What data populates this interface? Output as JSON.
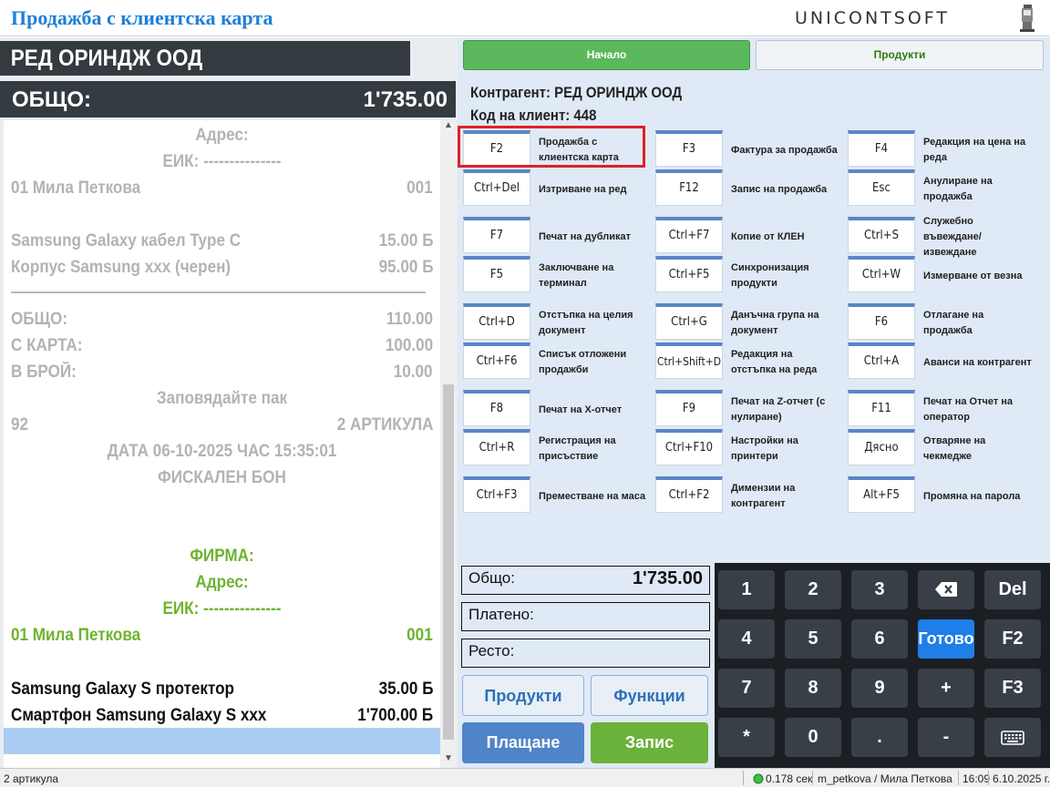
{
  "app": {
    "title": "Продажба с клиентска карта",
    "brand": "UNICONTSOFT"
  },
  "client": {
    "name": "РЕД ОРИНДЖ ООД"
  },
  "total": {
    "label": "ОБЩО:",
    "value": "1'735.00"
  },
  "receipt": {
    "address_label": "Адрес:",
    "eik": "ЕИК: ---------------",
    "operator": "01 Мила Петкова",
    "operator_code": "001",
    "items": [
      {
        "name": "Samsung Galaxy кабел Type C",
        "price": "15.00 Б"
      },
      {
        "name": "Корпус Samsung xxx (черен)",
        "price": "95.00 Б"
      }
    ],
    "totals": [
      {
        "label": "ОБЩО:",
        "value": "110.00"
      },
      {
        "label": "С КАРТА:",
        "value": "100.00"
      },
      {
        "label": "В БРОЙ:",
        "value": "10.00"
      }
    ],
    "thanks": "Заповядайте пак",
    "receipt_no": "92",
    "article_count": "2 АРТИКУЛА",
    "datetime": "ДАТА 06-10-2025  ЧАС 15:35:01",
    "fiscal": "ФИСКАЛЕН БОН",
    "firm_label": "ФИРМА:",
    "firm_address": "Адрес:",
    "firm_eik": "ЕИК: ---------------",
    "firm_operator": "01 Мила Петкова",
    "firm_operator_code": "001",
    "new_items": [
      {
        "name": "Samsung Galaxy S протектор",
        "price": "35.00 Б"
      },
      {
        "name": "Смартфон Samsung Galaxy S  xxx",
        "price": "1'700.00 Б"
      }
    ]
  },
  "tabs": {
    "home": "Начало",
    "products": "Продукти"
  },
  "contractor": {
    "label": "Контрагент: РЕД ОРИНДЖ ООД",
    "code": "Код на клиент: 448"
  },
  "hotkeys": [
    {
      "key": "F2",
      "label": "Продажба с клиентска карта"
    },
    {
      "key": "F3",
      "label": "Фактура за продажба"
    },
    {
      "key": "F4",
      "label": "Редакция на цена на реда"
    },
    {
      "key": "Ctrl+Del",
      "label": "Изтриване на ред"
    },
    {
      "key": "F12",
      "label": "Запис на продажба"
    },
    {
      "key": "Esc",
      "label": "Анулиране на продажба"
    },
    {
      "key": "F7",
      "label": "Печат на дубликат"
    },
    {
      "key": "Ctrl+F7",
      "label": "Копие от КЛЕН"
    },
    {
      "key": "Ctrl+S",
      "label": "Служебно въвеждане/извеждане"
    },
    {
      "key": "F5",
      "label": "Заключване на терминал"
    },
    {
      "key": "Ctrl+F5",
      "label": "Синхронизация продукти"
    },
    {
      "key": "Ctrl+W",
      "label": "Измерване от везна"
    },
    {
      "key": "Ctrl+D",
      "label": "Отстъпка на целия документ"
    },
    {
      "key": "Ctrl+G",
      "label": "Данъчна група на документ"
    },
    {
      "key": "F6",
      "label": "Отлагане на продажба"
    },
    {
      "key": "Ctrl+F6",
      "label": "Списък отложени продажби"
    },
    {
      "key": "Ctrl+Shift+D",
      "label": "Редакция на отстъпка на реда"
    },
    {
      "key": "Ctrl+A",
      "label": "Аванси на контрагент"
    },
    {
      "key": "F8",
      "label": "Печат на X-отчет"
    },
    {
      "key": "F9",
      "label": "Печат на Z-отчет (с нулиране)"
    },
    {
      "key": "F11",
      "label": "Печат на Отчет на оператор"
    },
    {
      "key": "Ctrl+R",
      "label": "Регистрация на присъствие"
    },
    {
      "key": "Ctrl+F10",
      "label": "Настройки на принтери"
    },
    {
      "key": "Дясно",
      "label": "Отваряне на чекмедже"
    },
    {
      "key": "Ctrl+F3",
      "label": "Преместване на маса"
    },
    {
      "key": "Ctrl+F2",
      "label": "Димензии на контрагент"
    },
    {
      "key": "Alt+F5",
      "label": "Промяна на парола"
    }
  ],
  "payment": {
    "total_label": "Общо:",
    "total_value": "1'735.00",
    "paid_label": "Платено:",
    "change_label": "Ресто:"
  },
  "buttons": {
    "products": "Продукти",
    "functions": "Функции",
    "pay": "Плащане",
    "save": "Запис"
  },
  "numpad": [
    "1",
    "2",
    "3",
    "backspace",
    "Del",
    "4",
    "5",
    "6",
    "Готово",
    "F2",
    "7",
    "8",
    "9",
    "+",
    "F3",
    "*",
    "0",
    ".",
    "-",
    "keyboard"
  ],
  "status": {
    "articles": "2 артикула",
    "time": "0.178 сек",
    "user": "m_petkova / Мила Петкова",
    "clock": "16:09",
    "date": "6.10.2025 г."
  }
}
